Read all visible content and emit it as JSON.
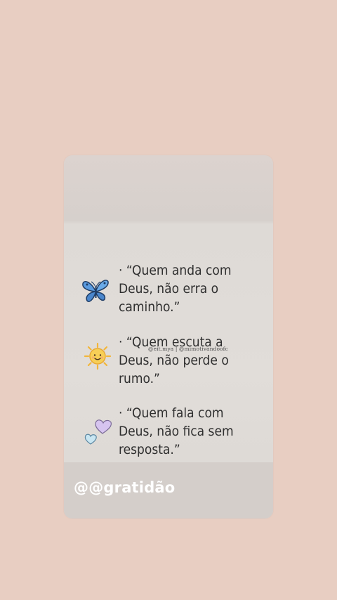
{
  "quotes": [
    {
      "line1": "· “Quem anda com",
      "line2": "Deus, não erra o",
      "line3": "caminho.”",
      "icon": "butterfly-icon"
    },
    {
      "line1": "· “Quem escuta a",
      "line2": "Deus, não perde o",
      "line3": "rumo.”",
      "icon": "sun-icon"
    },
    {
      "line1": "· “Quem fala com",
      "line2": "Deus, não fica sem",
      "line3": "resposta.”",
      "icon": "hearts-icon"
    }
  ],
  "watermark": "@eit.mya | @mimotivandoofc",
  "footer_text": "@@gratidão",
  "colors": {
    "background": "#e8cec2",
    "card": "#e0dcd8",
    "text": "#2f2f2f",
    "butterfly": "#5a9be0",
    "sun": "#f5c84a",
    "heart_purple": "#cbb6e8",
    "heart_blue": "#b9dcee"
  }
}
